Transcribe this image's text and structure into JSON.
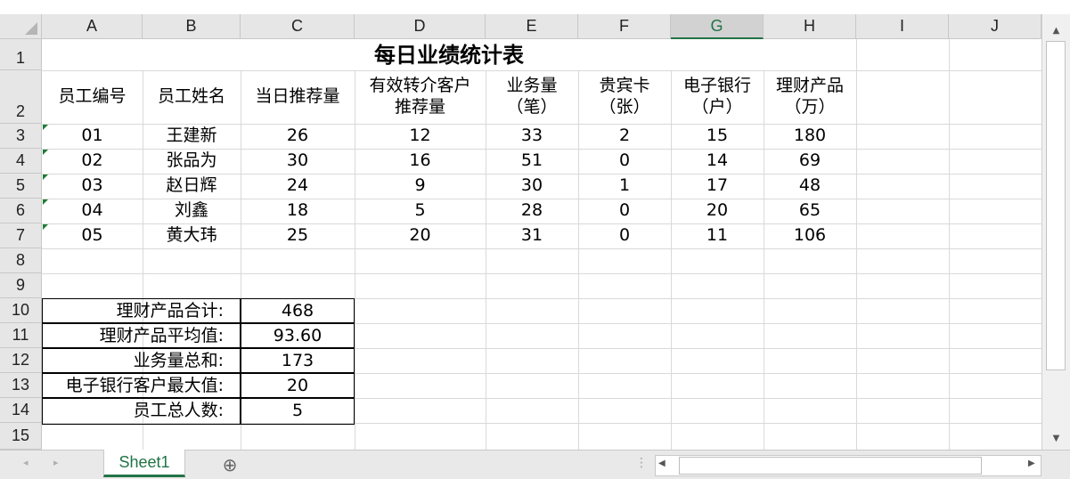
{
  "columns": [
    "A",
    "B",
    "C",
    "D",
    "E",
    "F",
    "G",
    "H",
    "I",
    "J"
  ],
  "rows": [
    "1",
    "2",
    "3",
    "4",
    "5",
    "6",
    "7",
    "8",
    "9",
    "10",
    "11",
    "12",
    "13",
    "14",
    "15"
  ],
  "title": "每日业绩统计表",
  "headers": {
    "a": "员工编号",
    "b": "员工姓名",
    "c": "当日推荐量",
    "d1": "有效转介客户",
    "d2": "推荐量",
    "e1": "业务量",
    "e2": "（笔）",
    "f1": "贵宾卡",
    "f2": "（张）",
    "g1": "电子银行",
    "g2": "（户）",
    "h1": "理财产品",
    "h2": "（万）"
  },
  "employees": [
    {
      "id": "01",
      "name": "王建新",
      "c": "26",
      "d": "12",
      "e": "33",
      "f": "2",
      "g": "15",
      "h": "180"
    },
    {
      "id": "02",
      "name": "张品为",
      "c": "30",
      "d": "16",
      "e": "51",
      "f": "0",
      "g": "14",
      "h": "69"
    },
    {
      "id": "03",
      "name": "赵日辉",
      "c": "24",
      "d": "9",
      "e": "30",
      "f": "1",
      "g": "17",
      "h": "48"
    },
    {
      "id": "04",
      "name": "刘鑫",
      "c": "18",
      "d": "5",
      "e": "28",
      "f": "0",
      "g": "20",
      "h": "65"
    },
    {
      "id": "05",
      "name": "黄大玮",
      "c": "25",
      "d": "20",
      "e": "31",
      "f": "0",
      "g": "11",
      "h": "106"
    }
  ],
  "summary": [
    {
      "label": "理财产品合计:",
      "value": "468"
    },
    {
      "label": "理财产品平均值:",
      "value": "93.60"
    },
    {
      "label": "业务量总和:",
      "value": "173"
    },
    {
      "label": "电子银行客户最大值:",
      "value": "20"
    },
    {
      "label": "员工总人数:",
      "value": "5"
    }
  ],
  "sheet_tab": "Sheet1",
  "add_sheet": "⊕",
  "colors": {
    "accent": "#217346",
    "header_bg": "#e6e6e6",
    "grid": "#d9d9d9"
  }
}
